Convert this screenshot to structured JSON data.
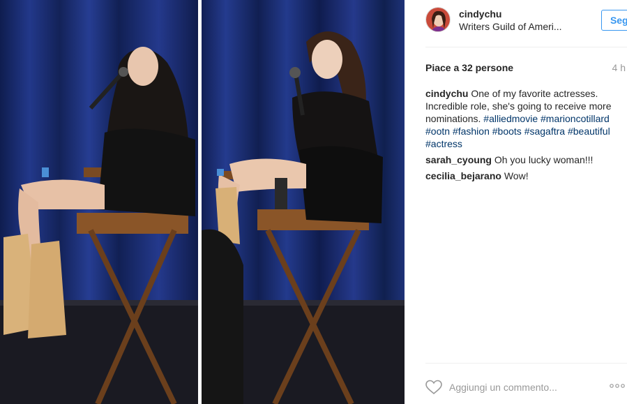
{
  "post": {
    "username": "cindychu",
    "location": "Writers Guild of Ameri...",
    "follow_label": "Segui",
    "likes": "Piace a 32 persone",
    "time": "4 h"
  },
  "caption": {
    "user": "cindychu",
    "text_before": " One of my favorite actresses. Incredible role, she's going to receive more nominations. ",
    "hashtags": [
      "#alliedmovie",
      "#marioncotillard",
      "#ootn",
      "#fashion",
      "#boots",
      "#sagaftra",
      "#beautiful",
      "#actress"
    ]
  },
  "comments": [
    {
      "user": "sarah_cyoung",
      "text": "Oh you lucky woman!!!"
    },
    {
      "user": "cecilia_bejarano",
      "text": "Wow!"
    }
  ],
  "add_comment": {
    "placeholder": "Aggiungi un commento..."
  },
  "icons": {
    "like": "heart-outline-icon",
    "more": "more-options-icon"
  },
  "colors": {
    "accent": "#3897f0",
    "hashtag": "#003569",
    "curtain": "#1b2c6e"
  }
}
